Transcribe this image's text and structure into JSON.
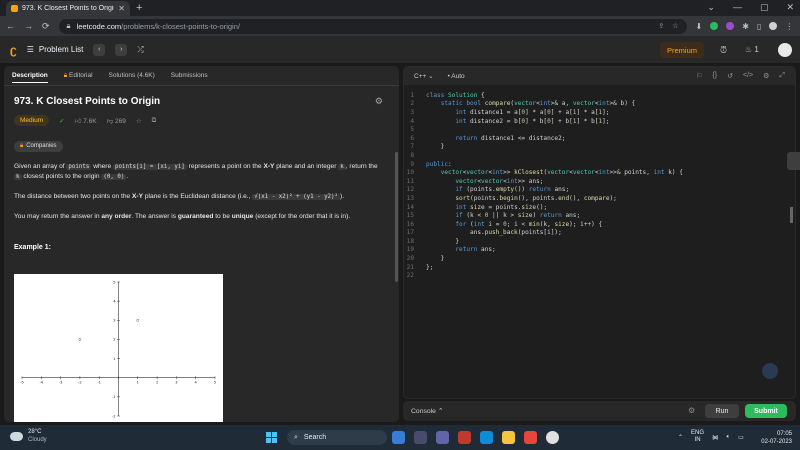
{
  "browser": {
    "tab_title": "973. K Closest Points to Origin - LeetC",
    "url_host": "leetcode.com",
    "url_path": "/problems/k-closest-points-to-origin/"
  },
  "nav": {
    "problem_list": "Problem List",
    "premium": "Premium",
    "streak": "1"
  },
  "left_tabs": [
    "Description",
    "Editorial",
    "Solutions (4.6K)",
    "Submissions"
  ],
  "problem": {
    "title": "973. K Closest Points to Origin",
    "difficulty": "Medium",
    "likes": "7.6K",
    "dislikes": "269",
    "companies": "Companies",
    "para1_a": "Given an array of ",
    "para1_code1": "points",
    "para1_b": " where ",
    "para1_code2": "points[i] = [xi, yi]",
    "para1_c": " represents a point on the ",
    "para1_bold": "X-Y",
    "para1_d": " plane and an integer ",
    "para1_code3": "k",
    "para1_e": ", return the ",
    "para1_code4": "k",
    "para1_f": " closest points to the origin ",
    "para1_code5": "(0, 0)",
    "para1_g": ".",
    "para2_a": "The distance between two points on the ",
    "para2_bold": "X-Y",
    "para2_b": " plane is the Euclidean distance (i.e., ",
    "para2_formula": "√(x1 - x2)² + (y1 - y2)²",
    "para2_c": ").",
    "para3_a": "You may return the answer in ",
    "para3_b1": "any order",
    "para3_c": ". The answer is ",
    "para3_b2": "guaranteed",
    "para3_d": " to be ",
    "para3_b3": "unique",
    "para3_e": " (except for the order that it is in).",
    "example1": "Example 1:"
  },
  "plot": {
    "x_ticks": [
      "-5",
      "-4",
      "-3",
      "-2",
      "-1",
      "0",
      "1",
      "2",
      "3",
      "4",
      "5"
    ],
    "y_ticks": [
      "5",
      "4",
      "3",
      "2",
      "1",
      "-1",
      "-2"
    ],
    "points": [
      {
        "label": "(-2, 2)",
        "x": -2,
        "y": 2
      },
      {
        "label": "(1, 3)",
        "x": 1,
        "y": 3
      }
    ],
    "x_range": [
      -5,
      5
    ],
    "y_range": [
      -2,
      5
    ]
  },
  "editor": {
    "language": "C++",
    "mode": "Auto",
    "lines": [
      "class Solution {",
      "    static bool compare(vector<int>& a, vector<int>& b) {",
      "        int distance1 = a[0] * a[0] + a[1] * a[1];",
      "        int distance2 = b[0] * b[0] + b[1] * b[1];",
      "",
      "        return distance1 <= distance2;",
      "    }",
      "",
      "public:",
      "    vector<vector<int>> kClosest(vector<vector<int>>& points, int k) {",
      "        vector<vector<int>> ans;",
      "        if (points.empty()) return ans;",
      "        sort(points.begin(), points.end(), compare);",
      "        int size = points.size();",
      "        if (k < 0 || k > size) return ans;",
      "        for (int i = 0; i < min(k, size); i++) {",
      "            ans.push_back(points[i]);",
      "        }",
      "        return ans;",
      "    }",
      "};",
      ""
    ]
  },
  "console": {
    "label": "Console",
    "run": "Run",
    "submit": "Submit"
  },
  "taskbar": {
    "temp": "28°C",
    "weather": "Cloudy",
    "search": "Search",
    "lang1": "ENG",
    "lang2": "IN",
    "time": "07:05",
    "date": "02-07-2023"
  }
}
